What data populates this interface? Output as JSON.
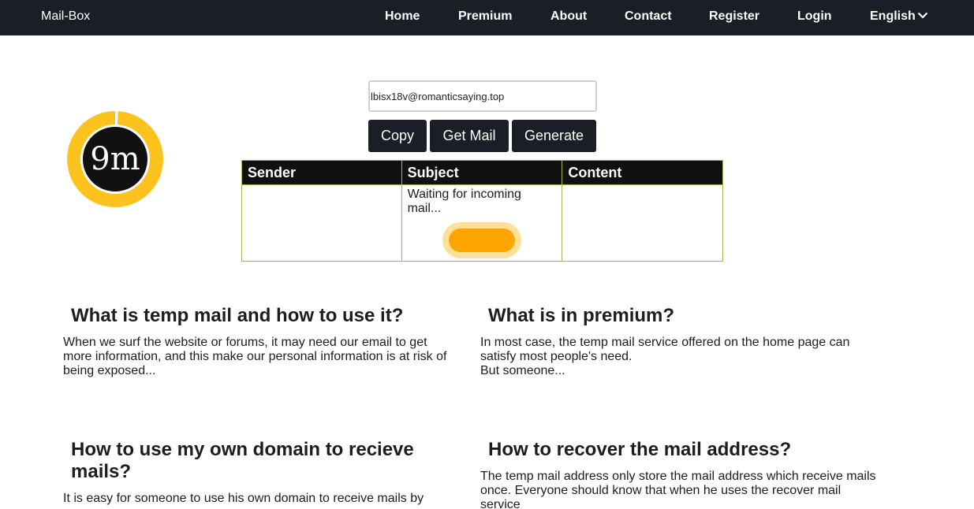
{
  "nav": {
    "brand": "Mail-Box",
    "links": [
      "Home",
      "Premium",
      "About",
      "Contact",
      "Register",
      "Login"
    ],
    "language": "English"
  },
  "timer": {
    "label": "9m",
    "remaining_fraction": 0.99
  },
  "mailbox": {
    "address": "lbisx18v@romanticsaying.top",
    "buttons": {
      "copy": "Copy",
      "get_mail": "Get Mail",
      "generate": "Generate"
    },
    "columns": [
      "Sender",
      "Subject",
      "Content"
    ],
    "waiting_text": "Waiting for incoming mail..."
  },
  "faq": [
    {
      "title": "What is temp mail and how to use it?",
      "body": "When we surf the website or forums, it may need our email to get more information, and this make our personal information is at risk of being exposed..."
    },
    {
      "title": "What is in premium?",
      "body": "In most case, the temp mail service offered on the home page can satisfy most people's need.",
      "body2": "But someone..."
    },
    {
      "title": "How to use my own domain to recieve mails?",
      "body": "It is easy for someone to use his own domain to receive mails by"
    },
    {
      "title": "How to recover the mail address?",
      "body": "The temp mail address only store the mail address which receive mails once. Everyone should know that when he uses the recover mail service"
    }
  ],
  "colors": {
    "navbar": "#1b1e27",
    "accent": "#fcc21e",
    "spinner": "#ffa500",
    "table_border": "#a7b54a"
  }
}
